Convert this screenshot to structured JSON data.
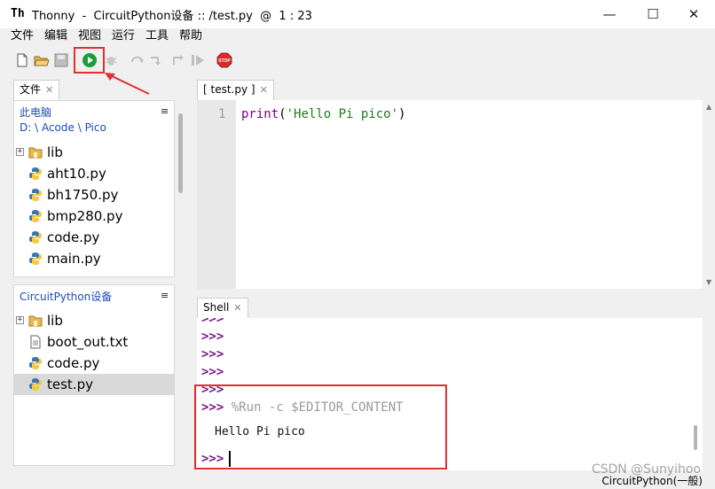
{
  "window": {
    "title": "Thonny  -  CircuitPython设备 :: /test.py  @  1 : 23",
    "app_icon": "Th",
    "minimize": "—",
    "maximize": "☐",
    "close": "✕"
  },
  "menu": [
    "文件",
    "编辑",
    "视图",
    "运行",
    "工具",
    "帮助"
  ],
  "toolbar": {
    "icons": [
      "new-file-icon",
      "open-file-icon",
      "save-icon",
      "run-icon",
      "debug-icon",
      "step-over-icon",
      "step-into-icon",
      "step-out-icon",
      "resume-icon",
      "stop-icon"
    ],
    "stop_label": "STOP"
  },
  "files_pane": {
    "tab_label": "文件",
    "tab_close": "✕",
    "this_pc": {
      "title": "此电脑",
      "path": "D: \\ Acode \\ Pico",
      "menu": "≡",
      "items": [
        {
          "name": "lib",
          "type": "folder",
          "expander": "+"
        },
        {
          "name": "aht10.py",
          "type": "python"
        },
        {
          "name": "bh1750.py",
          "type": "python"
        },
        {
          "name": "bmp280.py",
          "type": "python"
        },
        {
          "name": "code.py",
          "type": "python"
        },
        {
          "name": "main.py",
          "type": "python"
        }
      ]
    },
    "device": {
      "title": "CircuitPython设备",
      "menu": "≡",
      "items": [
        {
          "name": "lib",
          "type": "folder",
          "expander": "+"
        },
        {
          "name": "boot_out.txt",
          "type": "text"
        },
        {
          "name": "code.py",
          "type": "python"
        },
        {
          "name": "test.py",
          "type": "python",
          "selected": true
        }
      ]
    }
  },
  "editor": {
    "tab_label": "[ test.py ]",
    "tab_close": "✕",
    "line_number": "1",
    "code": {
      "func": "print",
      "open": "(",
      "string": "'Hello Pi pico'",
      "close": ")"
    }
  },
  "shell": {
    "tab_label": "Shell",
    "tab_close": "✕",
    "prompt": ">>>",
    "command": "%Run -c $EDITOR_CONTENT",
    "output": "Hello Pi pico"
  },
  "status": {
    "interpreter": "CircuitPython(一般)",
    "watermark": "CSDN @Sunyihoo"
  },
  "colors": {
    "highlight_red": "#e03030",
    "run_green": "#1a9c3a",
    "prompt_purple": "#7a1a8a",
    "string_green": "#1b7c1b"
  }
}
